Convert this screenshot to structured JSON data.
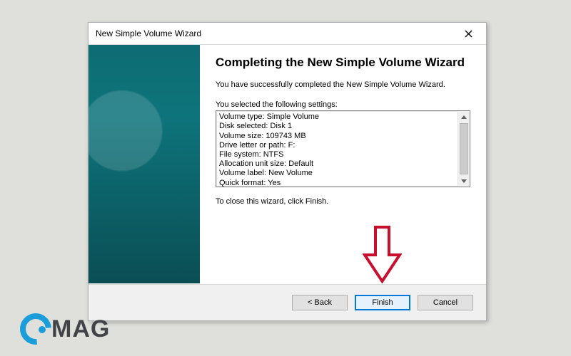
{
  "window": {
    "title": "New Simple Volume Wizard",
    "close_label": "Close"
  },
  "heading": "Completing the New Simple Volume Wizard",
  "success_msg": "You have successfully completed the New Simple Volume Wizard.",
  "settings_label": "You selected the following settings:",
  "settings": [
    "Volume type: Simple Volume",
    "Disk selected: Disk 1",
    "Volume size: 109743 MB",
    "Drive letter or path: F:",
    "File system: NTFS",
    "Allocation unit size: Default",
    "Volume label: New Volume",
    "Quick format: Yes"
  ],
  "finish_hint": "To close this wizard, click Finish.",
  "buttons": {
    "back": "< Back",
    "finish": "Finish",
    "cancel": "Cancel"
  },
  "logo_text": "MAG"
}
